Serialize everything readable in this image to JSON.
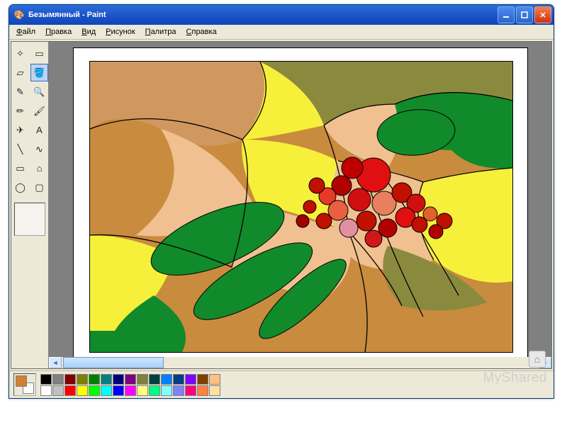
{
  "window": {
    "title": "Безымянный - Paint"
  },
  "menu": {
    "items": [
      {
        "label": "Файл",
        "accel": "Ф",
        "rest": "айл"
      },
      {
        "label": "Правка",
        "accel": "П",
        "rest": "равка"
      },
      {
        "label": "Вид",
        "accel": "В",
        "rest": "ид"
      },
      {
        "label": "Рисунок",
        "accel": "Р",
        "rest": "исунок"
      },
      {
        "label": "Палитра",
        "accel": "П",
        "rest": "алитра"
      },
      {
        "label": "Справка",
        "accel": "С",
        "rest": "правка"
      }
    ]
  },
  "tools": {
    "list": [
      {
        "name": "freeform-select",
        "g": "✧"
      },
      {
        "name": "rect-select",
        "g": "▭"
      },
      {
        "name": "eraser",
        "g": "▱"
      },
      {
        "name": "fill",
        "g": "🪣",
        "sel": true
      },
      {
        "name": "picker",
        "g": "✎"
      },
      {
        "name": "magnifier",
        "g": "🔍"
      },
      {
        "name": "pencil",
        "g": "✏"
      },
      {
        "name": "brush",
        "g": "🖌"
      },
      {
        "name": "airbrush",
        "g": "✈"
      },
      {
        "name": "text",
        "g": "A"
      },
      {
        "name": "line",
        "g": "╲"
      },
      {
        "name": "curve",
        "g": "∿"
      },
      {
        "name": "rectangle",
        "g": "▭"
      },
      {
        "name": "polygon",
        "g": "⌂"
      },
      {
        "name": "ellipse",
        "g": "◯"
      },
      {
        "name": "roundrect",
        "g": "▢"
      }
    ]
  },
  "colors": {
    "current": {
      "fg": "#d08030",
      "bg": "#ffffff"
    },
    "row1": [
      "#000000",
      "#808080",
      "#800000",
      "#808000",
      "#008000",
      "#008080",
      "#000080",
      "#800080",
      "#808040",
      "#004040",
      "#0080ff",
      "#004080",
      "#8000ff",
      "#804000",
      "#ffc080"
    ],
    "row2": [
      "#ffffff",
      "#c0c0c0",
      "#ff0000",
      "#ffff00",
      "#00ff00",
      "#00ffff",
      "#0000ff",
      "#ff00ff",
      "#ffff80",
      "#00ff80",
      "#80ffff",
      "#8080ff",
      "#ff0080",
      "#ff8040",
      "#ffe0a0"
    ]
  },
  "watermark": "MyShared"
}
